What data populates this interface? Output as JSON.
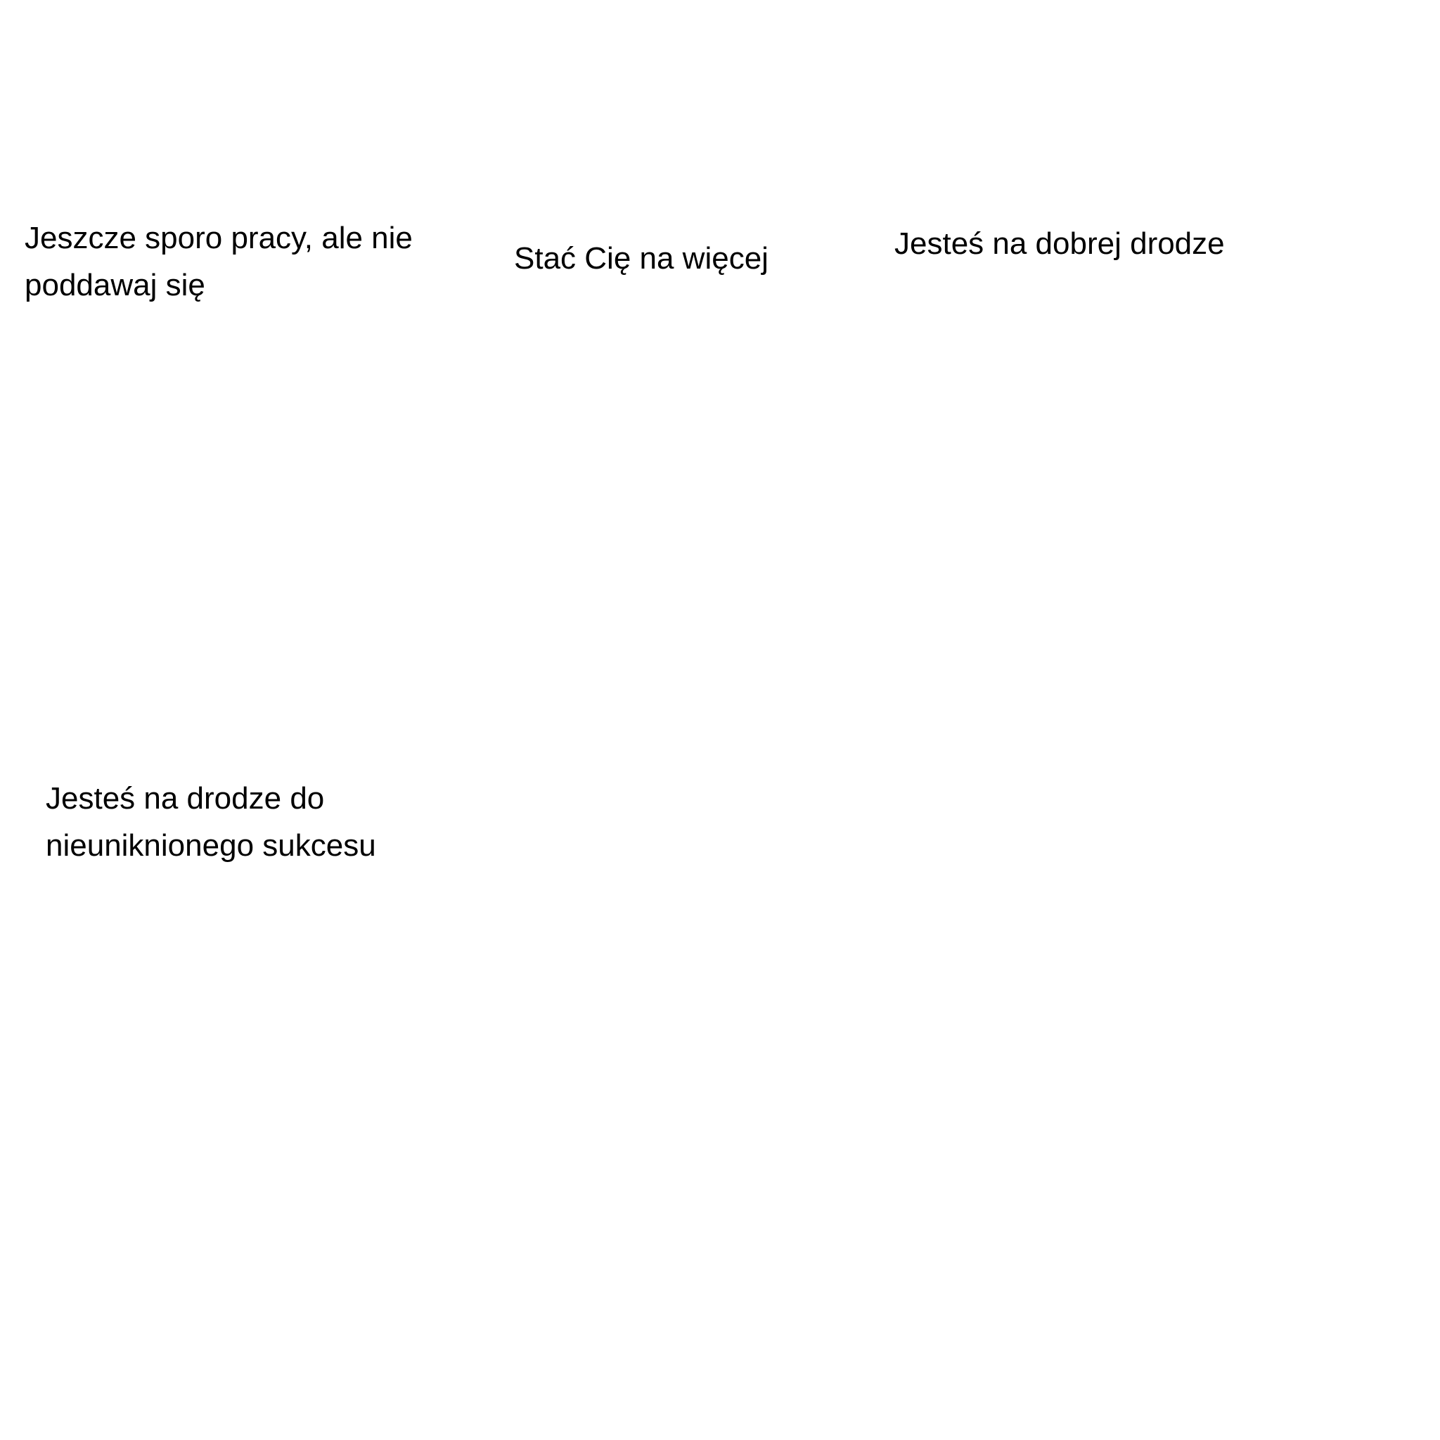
{
  "messages": [
    {
      "id": "msg-1",
      "lines": [
        "Jeszcze sporo pracy, ale nie",
        "poddawaj się"
      ]
    },
    {
      "id": "msg-2",
      "lines": [
        "Stać Cię na więcej"
      ]
    },
    {
      "id": "msg-3",
      "lines": [
        "Jesteś na dobrej drodze"
      ]
    },
    {
      "id": "msg-4",
      "lines": [
        "Jesteś na drodze do",
        "nieuniknionego sukcesu"
      ]
    }
  ]
}
